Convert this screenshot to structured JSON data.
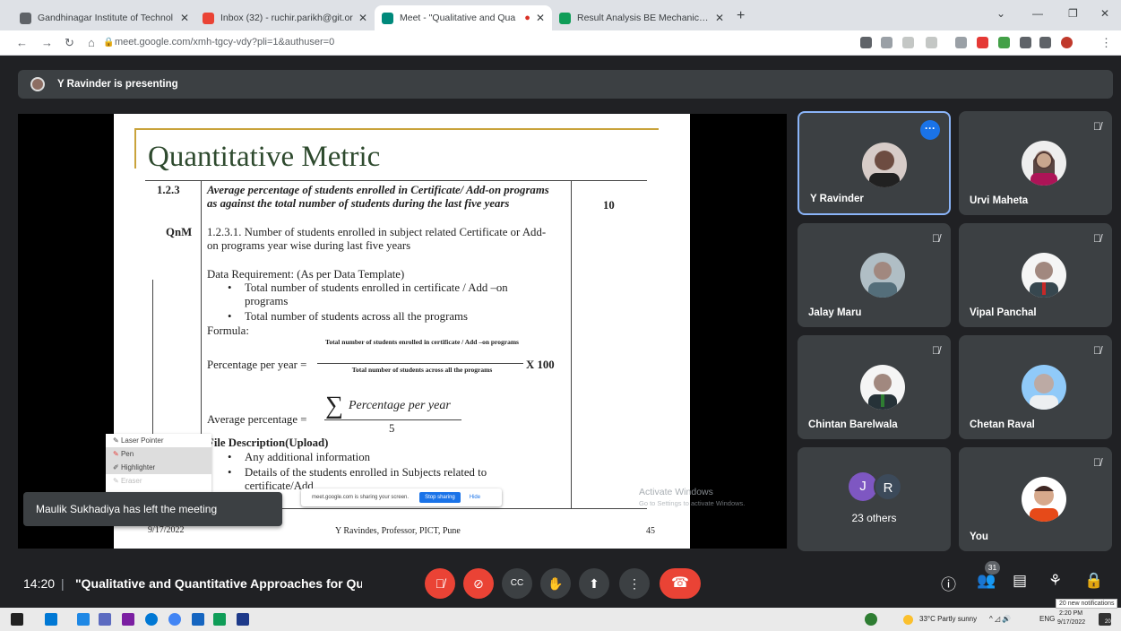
{
  "browser": {
    "tabs": [
      {
        "title": "Gandhinagar Institute of Technol",
        "color": "#5f6368"
      },
      {
        "title": "Inbox (32) - ruchir.parikh@git.or",
        "color": "#ea4335"
      },
      {
        "title": "Meet - \"Qualitative and Qua",
        "color": "#00897b"
      },
      {
        "title": "Result Analysis BE Mechanical Se",
        "color": "#0f9d58"
      }
    ],
    "url": "meet.google.com/xmh-tgcy-vdy?pli=1&authuser=0"
  },
  "presenting": "Y Ravinder is presenting",
  "slide": {
    "title": "Quantitative Metric",
    "metric_no": "1.2.3",
    "metric_type": "QnM",
    "metric_desc": "Average percentage of students enrolled in Certificate/ Add-on programs as against the total number of students during the last five years",
    "marks": "10",
    "sub_metric": "1.2.3.1. Number of students enrolled in subject related Certificate or Add-on programs year wise during last five years",
    "data_req": "Data Requirement: (As per Data Template)",
    "bullet1": "Total number of students enrolled in certificate / Add –on programs",
    "bullet2": "Total number of students across all the programs",
    "formula_label": "Formula:",
    "ppy_label": "Percentage per year =",
    "numerator": "Total number of students enrolled in certificate / Add –on programs",
    "denominator": "Total number of students across all the programs",
    "times": "X 100",
    "avg_label": "Average percentage =",
    "avg_num": "Percentage per year",
    "avg_den": "5",
    "file_desc": "File Description(Upload)",
    "file_b1": "Any additional information",
    "file_b2": "Details of the students enrolled in Subjects related to certificate/Add",
    "footer_date": "9/17/2022",
    "footer": "Y Ravindes, Professor, PICT, Pune",
    "page": "45"
  },
  "tools": [
    "Laser Pointer",
    "Pen",
    "Highlighter",
    "Eraser"
  ],
  "toast": "Maulik Sukhadiya has left the meeting",
  "share": {
    "text": "meet.google.com is sharing your screen.",
    "stop": "Stop sharing",
    "hide": "Hide"
  },
  "activate": {
    "line1": "Activate Windows",
    "line2": "Go to Settings to activate Windows."
  },
  "participants": [
    {
      "name": "Y Ravinder"
    },
    {
      "name": "Urvi Maheta"
    },
    {
      "name": "Jalay Maru"
    },
    {
      "name": "Vipal Panchal"
    },
    {
      "name": "Chintan Barelwala"
    },
    {
      "name": "Chetan Raval"
    },
    {
      "name": "23 others",
      "initials": [
        "J",
        "R"
      ]
    },
    {
      "name": "You"
    }
  ],
  "meeting": {
    "time": "14:20",
    "separator": "|",
    "title": "\"Qualitative and Quantitative Approaches for Quali...",
    "people_count": "31"
  },
  "taskbar": {
    "weather": "33°C  Partly sunny",
    "lang": "ENG",
    "clock": "2:20 PM",
    "date": "9/17/2022",
    "notifications": "20 new notifications",
    "notif_badge": "20"
  }
}
